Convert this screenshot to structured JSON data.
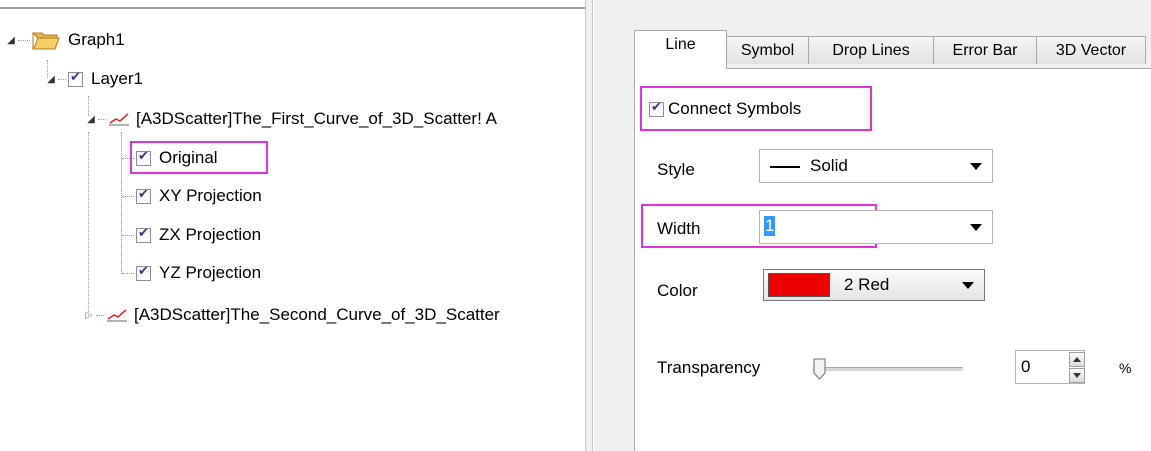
{
  "tree": {
    "root_label": "Graph1",
    "layer_label": "Layer1",
    "curve1_label": "[A3DScatter]The_First_Curve_of_3D_Scatter! A",
    "curve1_children": [
      "Original",
      "XY Projection",
      "ZX Projection",
      "YZ Projection"
    ],
    "curve2_label": "[A3DScatter]The_Second_Curve_of_3D_Scatter"
  },
  "tabs": [
    "Line",
    "Symbol",
    "Drop Lines",
    "Error Bar",
    "3D Vector"
  ],
  "active_tab": "Line",
  "line_page": {
    "connect_label": "Connect Symbols",
    "connect_checked": true,
    "style_label": "Style",
    "style_value": "Solid",
    "width_label": "Width",
    "width_value": "1",
    "color_label": "Color",
    "color_value": "2 Red",
    "color_swatch": "#ee0000",
    "transparency_label": "Transparency",
    "transparency_value": "0",
    "transparency_unit": "%"
  },
  "colors": {
    "highlight": "#e033e0",
    "curve_icon": "#e02020"
  }
}
